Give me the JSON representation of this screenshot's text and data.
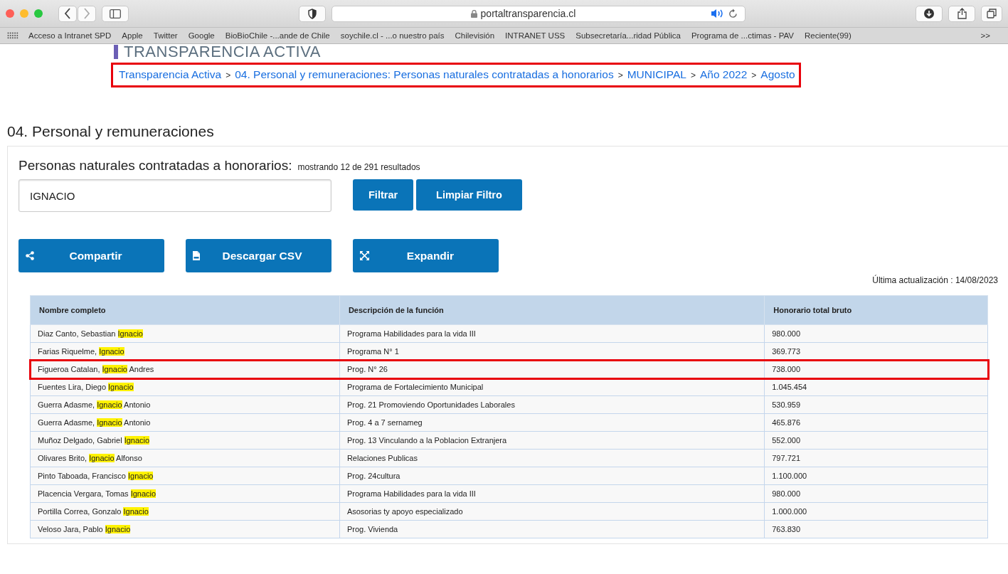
{
  "browser": {
    "url": "portaltransparencia.cl",
    "overflow": ">>",
    "bookmarks": [
      "Acceso a Intranet SPD",
      "Apple",
      "Twitter",
      "Google",
      "BioBioChile -...ande de Chile",
      "soychile.cl - ...o nuestro país",
      "Chilevisión",
      "INTRANET USS",
      "Subsecretaría...ridad Pública",
      "Programa de ...ctimas - PAV",
      "Reciente(99)"
    ]
  },
  "page": {
    "header_title": "TRANSPARENCIA ACTIVA",
    "breadcrumb": {
      "annotated": true,
      "items": [
        "Transparencia Activa",
        "04. Personal y remuneraciones: Personas naturales contratadas a honorarios",
        "MUNICIPAL",
        "Año 2022",
        "Agosto"
      ],
      "separator": ">"
    },
    "section_title": "04. Personal y remuneraciones",
    "panel": {
      "title": "Personas naturales contratadas a honorarios:",
      "result_count": "mostrando 12 de 291 resultados",
      "search": {
        "value": "IGNACIO"
      },
      "filter_buttons": [
        "Filtrar",
        "Limpiar Filtro"
      ],
      "actions": [
        {
          "kind": "share",
          "label": "Compartir"
        },
        {
          "kind": "csv",
          "label": "Descargar CSV"
        },
        {
          "kind": "expand",
          "label": "Expandir"
        }
      ],
      "last_updated": "Última actualización : 14/08/2023"
    },
    "table": {
      "columns": [
        "Nombre completo",
        "Descripción de la función",
        "Honorario total bruto"
      ],
      "rows": [
        {
          "annotated": false,
          "name": [
            {
              "text": "Diaz Canto, Sebastian ",
              "highlighted": false
            },
            {
              "text": "Ignacio",
              "highlighted": true
            }
          ],
          "function": "Programa Habilidades para la vida III",
          "amount": "980.000"
        },
        {
          "annotated": false,
          "name": [
            {
              "text": "Farias Riquelme, ",
              "highlighted": false
            },
            {
              "text": "Ignacio",
              "highlighted": true
            }
          ],
          "function": "Programa N° 1",
          "amount": "369.773"
        },
        {
          "annotated": true,
          "name": [
            {
              "text": "Figueroa Catalan, ",
              "highlighted": false
            },
            {
              "text": "Ignacio",
              "highlighted": true
            },
            {
              "text": " Andres",
              "highlighted": false
            }
          ],
          "function": "Prog. N° 26",
          "amount": "738.000"
        },
        {
          "annotated": false,
          "name": [
            {
              "text": "Fuentes Lira, Diego ",
              "highlighted": false
            },
            {
              "text": "Ignacio",
              "highlighted": true
            }
          ],
          "function": "Programa de Fortalecimiento Municipal",
          "amount": "1.045.454"
        },
        {
          "annotated": false,
          "name": [
            {
              "text": "Guerra Adasme, ",
              "highlighted": false
            },
            {
              "text": "Ignacio",
              "highlighted": true
            },
            {
              "text": " Antonio",
              "highlighted": false
            }
          ],
          "function": "Prog. 21 Promoviendo Oportunidades Laborales",
          "amount": "530.959"
        },
        {
          "annotated": false,
          "name": [
            {
              "text": "Guerra Adasme, ",
              "highlighted": false
            },
            {
              "text": "Ignacio",
              "highlighted": true
            },
            {
              "text": " Antonio",
              "highlighted": false
            }
          ],
          "function": "Prog. 4 a 7 sernameg",
          "amount": "465.876"
        },
        {
          "annotated": false,
          "name": [
            {
              "text": "Muñoz Delgado, Gabriel ",
              "highlighted": false
            },
            {
              "text": "Ignacio",
              "highlighted": true
            }
          ],
          "function": "Prog. 13 Vinculando a la Poblacion Extranjera",
          "amount": "552.000"
        },
        {
          "annotated": false,
          "name": [
            {
              "text": "Olivares Brito, ",
              "highlighted": false
            },
            {
              "text": "Ignacio",
              "highlighted": true
            },
            {
              "text": " Alfonso",
              "highlighted": false
            }
          ],
          "function": "Relaciones Publicas",
          "amount": "797.721"
        },
        {
          "annotated": false,
          "name": [
            {
              "text": "Pinto Taboada, Francisco ",
              "highlighted": false
            },
            {
              "text": "Ignacio",
              "highlighted": true
            }
          ],
          "function": "Prog. 24cultura",
          "amount": "1.100.000"
        },
        {
          "annotated": false,
          "name": [
            {
              "text": "Placencia Vergara, Tomas ",
              "highlighted": false
            },
            {
              "text": "Ignacio",
              "highlighted": true
            }
          ],
          "function": "Programa Habilidades para la vida III",
          "amount": "980.000"
        },
        {
          "annotated": false,
          "name": [
            {
              "text": "Portilla Correa, Gonzalo ",
              "highlighted": false
            },
            {
              "text": "Ignacio",
              "highlighted": true
            }
          ],
          "function": "Asosorias ty apoyo especializado",
          "amount": "1.000.000"
        },
        {
          "annotated": false,
          "name": [
            {
              "text": "Veloso Jara, Pablo ",
              "highlighted": false
            },
            {
              "text": "Ignacio",
              "highlighted": true
            }
          ],
          "function": "Prog. Vivienda",
          "amount": "763.830"
        }
      ]
    }
  }
}
